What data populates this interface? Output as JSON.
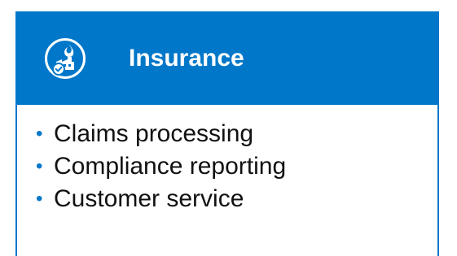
{
  "card": {
    "title": "Insurance",
    "icon": "insurance-factory-icon",
    "accent_color": "#0077c8",
    "items": [
      {
        "bullet": "•",
        "label": "Claims processing"
      },
      {
        "bullet": "•",
        "label": "Compliance reporting"
      },
      {
        "bullet": "•",
        "label": "Customer service"
      }
    ]
  }
}
